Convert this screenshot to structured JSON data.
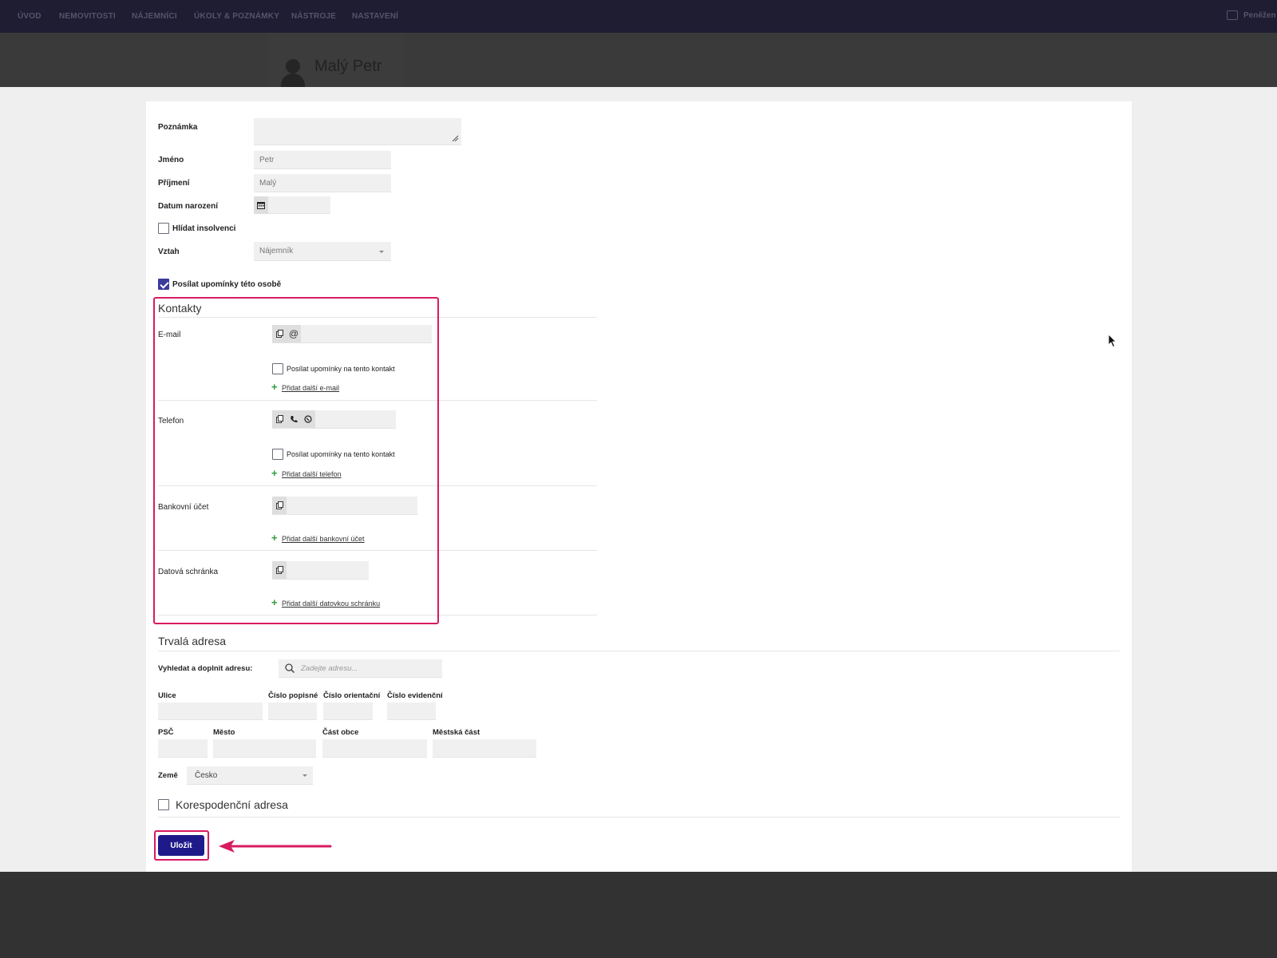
{
  "nav": {
    "items": [
      "ÚVOD",
      "NEMOVITOSTI",
      "NÁJEMNÍCI",
      "ÚKOLY & POZNÁMKY",
      "NÁSTROJE",
      "NASTAVENÍ"
    ],
    "wallet_label": "Peněžen"
  },
  "header": {
    "name": "Malý Petr"
  },
  "form": {
    "note_label": "Poznámka",
    "first_name_label": "Jméno",
    "first_name_value": "Petr",
    "last_name_label": "Příjmení",
    "last_name_value": "Malý",
    "birth_label": "Datum narození",
    "insolvency_label": "Hlídat insolvenci",
    "relation_label": "Vztah",
    "relation_value": "Nájemník",
    "reminders_label": "Posílat upomínky této osobě"
  },
  "contacts": {
    "title": "Kontakty",
    "email_label": "E-mail",
    "email_reminder": "Posílat upomínky na tento kontakt",
    "email_add": "Přidat další e-mail",
    "phone_label": "Telefon",
    "phone_reminder": "Posílat upomínky na tento kontakt",
    "phone_add": "Přidat další telefon",
    "bank_label": "Bankovní účet",
    "bank_add": "Přidat další bankovní účet",
    "databox_label": "Datová schránka",
    "databox_add": "Přidat další datovkou schránku"
  },
  "address": {
    "title": "Trvalá adresa",
    "search_label": "Vyhledat a doplnit adresu:",
    "search_placeholder": "Zadejte adresu...",
    "street": "Ulice",
    "house_no": "Číslo popisné",
    "orient_no": "Číslo orientační",
    "evid_no": "Číslo evidenční",
    "zip": "PSČ",
    "city": "Město",
    "city_part": "Část obce",
    "district": "Městská část",
    "country_label": "Země",
    "country_value": "Česko",
    "corr_label": "Korespodenční adresa"
  },
  "save_label": "Uložit",
  "colors": {
    "accent": "#1f1a8a",
    "highlight": "#d81b60",
    "nav_bg": "#1e1d32",
    "plus": "#2e9b3a"
  }
}
